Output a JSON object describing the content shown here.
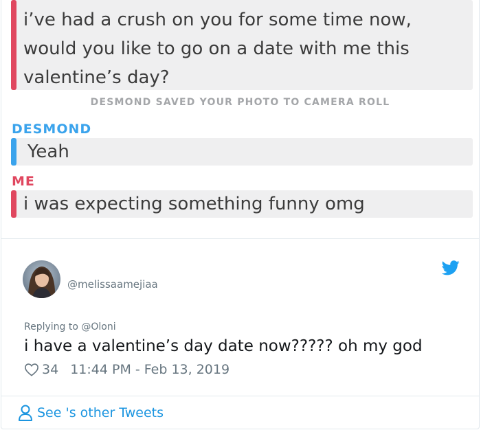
{
  "snapchat": {
    "first_message": "i’ve had a crush on you for some time now, would you like to go on a date with me this valentine’s day?",
    "saved_notice": "DESMOND SAVED YOUR PHOTO TO CAMERA ROLL",
    "sender_desmond": "DESMOND",
    "desmond_reply": "Yeah",
    "sender_me": "ME",
    "me_reply": "i was expecting something funny omg"
  },
  "tweet": {
    "handle": "@melissaamejiaa",
    "replying_to": "Replying to @Oloni",
    "text": "i have a valentine’s day date now????? oh my god",
    "likes": "34",
    "timestamp": "11:44 PM - Feb 13, 2019",
    "see_other": "See 's other Tweets"
  },
  "colors": {
    "snap_red": "#e0475f",
    "snap_blue": "#3aa3ec",
    "twitter_blue": "#1b95e0",
    "bubble_gray": "#efeff0"
  },
  "icons": {
    "heart": "heart-icon",
    "bird": "twitter-bird-icon",
    "person": "person-icon"
  }
}
